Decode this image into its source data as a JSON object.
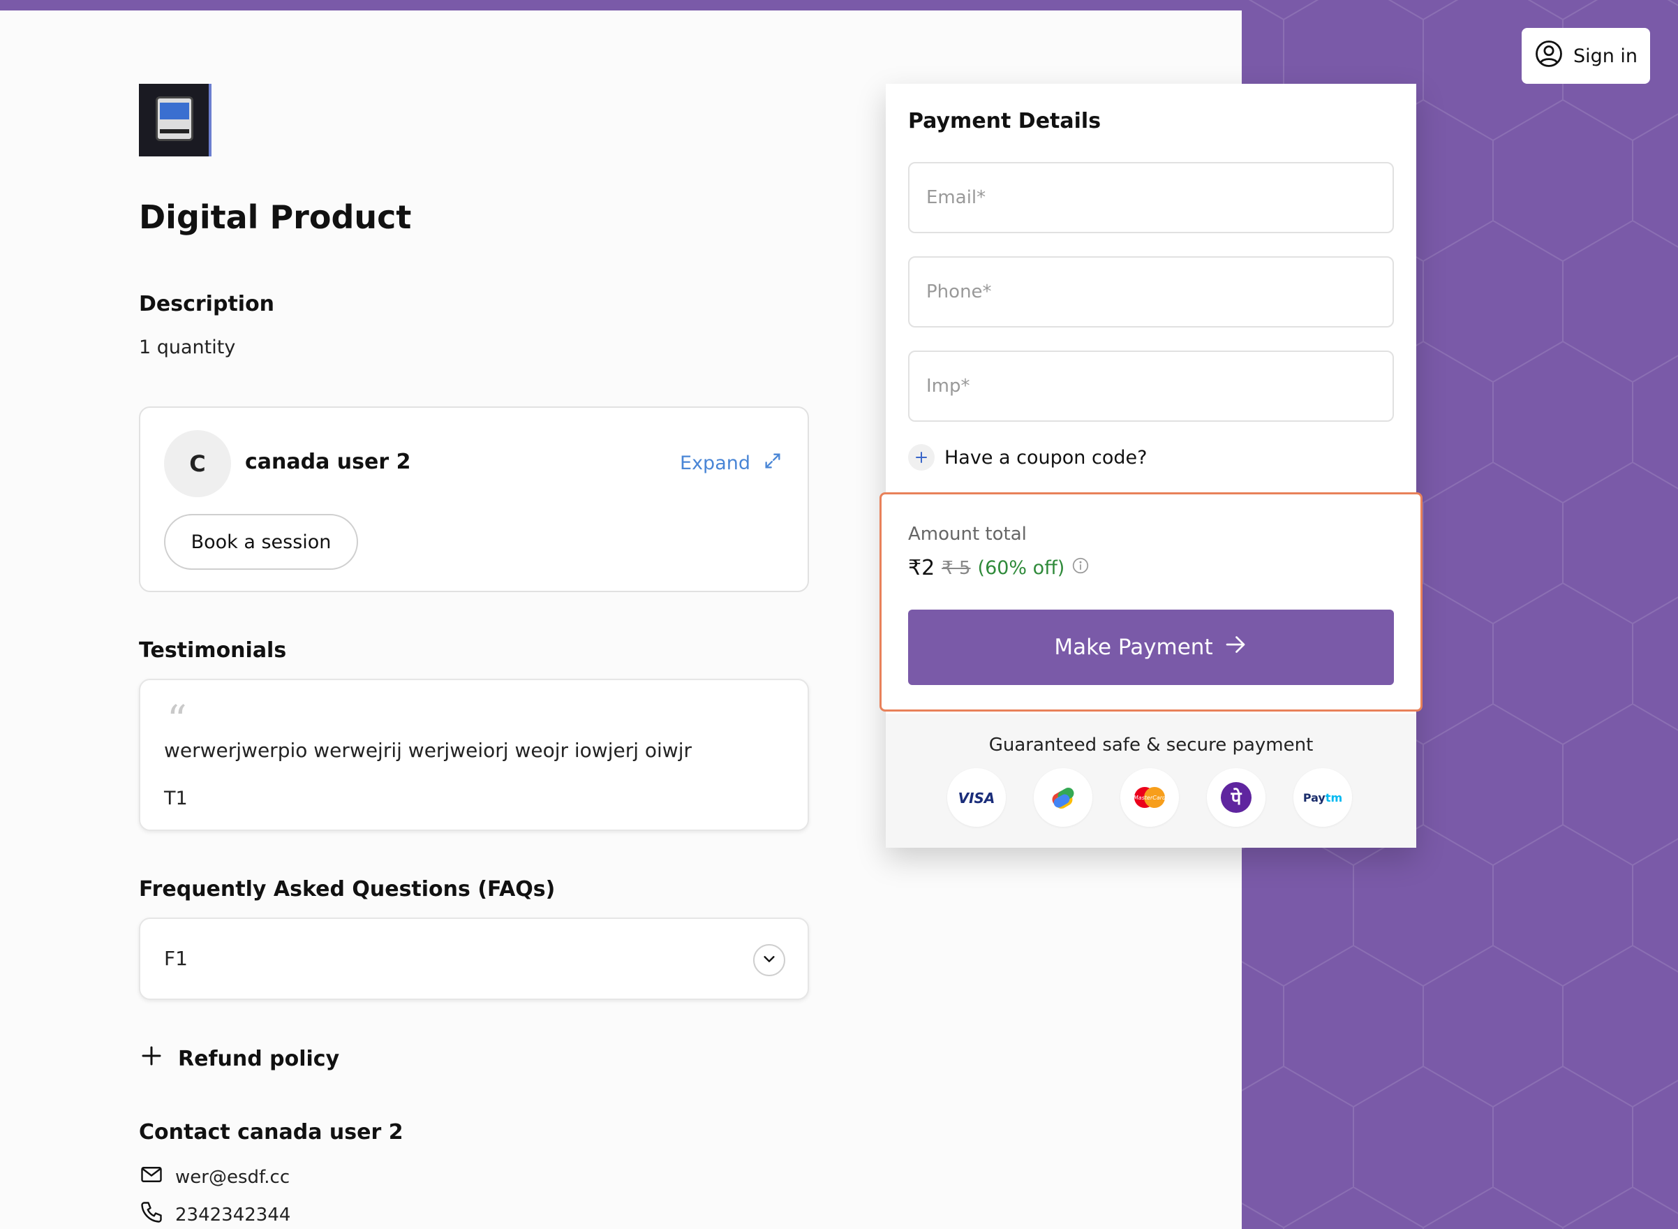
{
  "header": {
    "signin_label": "Sign in"
  },
  "product": {
    "title": "Digital Product",
    "description_heading": "Description",
    "description_text": "1 quantity"
  },
  "creator": {
    "avatar_initial": "C",
    "name": "canada user 2",
    "expand_label": "Expand",
    "book_label": "Book a session"
  },
  "testimonials": {
    "heading": "Testimonials",
    "items": [
      {
        "text": "werwerjwerpio werwejrij werjweiorj weojr iowjerj oiwjr",
        "author": "T1"
      }
    ]
  },
  "faqs": {
    "heading": "Frequently Asked Questions (FAQs)",
    "items": [
      {
        "question": "F1"
      }
    ]
  },
  "refund": {
    "label": "Refund policy"
  },
  "contact": {
    "heading": "Contact canada user 2",
    "email": "wer@esdf.cc",
    "phone": "2342342344"
  },
  "payment": {
    "title": "Payment Details",
    "email_placeholder": "Email*",
    "phone_placeholder": "Phone*",
    "imp_placeholder": "Imp*",
    "coupon_label": "Have a coupon code?",
    "amount_label": "Amount total",
    "amount_now": "₹2",
    "amount_old": "₹ 5",
    "amount_off": "(60% off)",
    "make_payment_label": "Make Payment",
    "secure_text": "Guaranteed safe & secure payment",
    "logos": [
      "VISA",
      "Google Pay",
      "MasterCard",
      "PhonePe",
      "Paytm"
    ]
  },
  "colors": {
    "brand": "#7a5aa8",
    "highlight": "#e8815a",
    "discount": "#2f8a3a",
    "link": "#4a86d6"
  },
  "icons": {
    "signin": "user-circle-icon",
    "expand": "expand-icon",
    "quote": "quote-icon",
    "chevron": "chevron-down-icon",
    "refund": "plus-icon",
    "email": "mail-icon",
    "phone": "phone-icon",
    "coupon": "plus-icon",
    "info": "info-icon",
    "arrow": "arrow-right-icon"
  }
}
